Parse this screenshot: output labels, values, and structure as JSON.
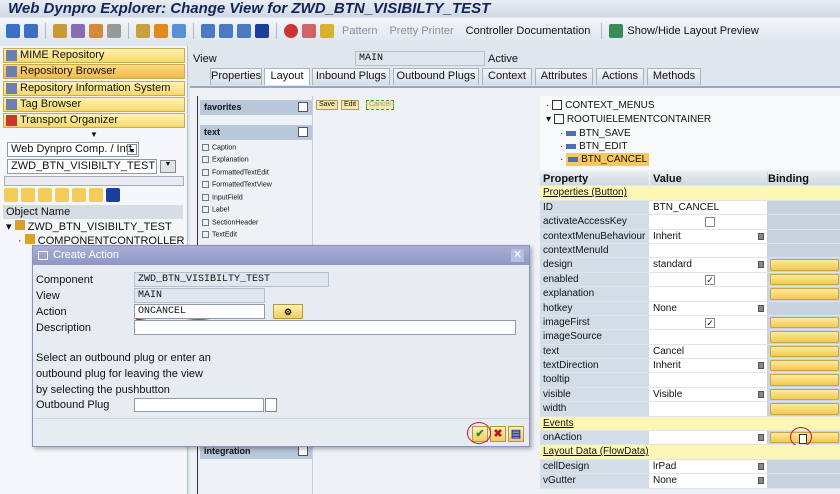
{
  "window": {
    "title": "Web Dynpro Explorer: Change View for ZWD_BTN_VISIBILTY_TEST"
  },
  "toolbar": {
    "pattern": "Pattern",
    "pretty_printer": "Pretty Printer",
    "controller_doc": "Controller Documentation",
    "layout_preview": "Show/Hide Layout Preview"
  },
  "nav": [
    "MIME Repository",
    "Repository Browser",
    "Repository Information System",
    "Tag Browser",
    "Transport Organizer"
  ],
  "browser": {
    "type_select": "Web Dynpro Comp. / Intf.",
    "object_input": "ZWD_BTN_VISIBILTY_TEST",
    "column_header": "Object Name",
    "tree": [
      "ZWD_BTN_VISIBILTY_TEST",
      "COMPONENTCONTROLLER"
    ]
  },
  "view": {
    "label": "View",
    "name": "MAIN",
    "status": "Active",
    "tabs": [
      "Properties",
      "Layout",
      "Inbound Plugs",
      "Outbound Plugs",
      "Context",
      "Attributes",
      "Actions",
      "Methods"
    ],
    "active_tab": "Layout"
  },
  "palette": {
    "favorites": "favorites",
    "text": "text",
    "items": [
      "Caption",
      "Explanation",
      "FormattedTextEdit",
      "FormattedTextView",
      "InputField",
      "Label",
      "SectionHeader",
      "TextEdit"
    ],
    "integration": "integration"
  },
  "canvas": {
    "buttons": [
      "Save",
      "Edit",
      "Cancel"
    ]
  },
  "ui_tree": [
    "CONTEXT_MENUS",
    "ROOTUIELEMENTCONTAINER",
    "BTN_SAVE",
    "BTN_EDIT",
    "BTN_CANCEL"
  ],
  "properties": {
    "headers": [
      "Property",
      "Value",
      "Binding"
    ],
    "rows": [
      {
        "type": "section",
        "name": "Properties (Button)"
      },
      {
        "name": "ID",
        "value": "BTN_CANCEL"
      },
      {
        "name": "activateAccessKey",
        "check": false
      },
      {
        "name": "contextMenuBehaviour",
        "value": "Inherit",
        "dd": true
      },
      {
        "name": "contextMenuId",
        "value": ""
      },
      {
        "name": "design",
        "value": "standard",
        "dd": true,
        "bind": true
      },
      {
        "name": "enabled",
        "check": true,
        "bind": true
      },
      {
        "name": "explanation",
        "value": "",
        "bind": true
      },
      {
        "name": "hotkey",
        "value": "None",
        "dd": true
      },
      {
        "name": "imageFirst",
        "check": true,
        "bind": true
      },
      {
        "name": "imageSource",
        "value": "",
        "bind": true
      },
      {
        "name": "text",
        "value": "Cancel",
        "bind": true
      },
      {
        "name": "textDirection",
        "value": "Inherit",
        "dd": true,
        "bind": true
      },
      {
        "name": "tooltip",
        "value": "",
        "bind": true
      },
      {
        "name": "visible",
        "value": "Visible",
        "dd": true,
        "bind": true
      },
      {
        "name": "width",
        "value": "",
        "bind": true
      },
      {
        "type": "section",
        "name": "Events"
      },
      {
        "name": "onAction",
        "value": "",
        "dd": true,
        "bind": true,
        "create": true
      },
      {
        "type": "section",
        "name": "Layout Data (FlowData)"
      },
      {
        "name": "cellDesign",
        "value": "lrPad",
        "dd": true
      },
      {
        "name": "vGutter",
        "value": "None",
        "dd": true
      }
    ]
  },
  "dialog": {
    "title": "Create Action",
    "component_label": "Component",
    "component": "ZWD_BTN_VISIBILTY_TEST",
    "view_label": "View",
    "view": "MAIN",
    "action_label": "Action",
    "action": "ONCANCEL",
    "description_label": "Description",
    "description": "",
    "hint": [
      "Select an outbound plug or enter an",
      "outbound plug for leaving the view",
      "by selecting the pushbutton"
    ],
    "outbound_label": "Outbound Plug",
    "outbound": ""
  }
}
